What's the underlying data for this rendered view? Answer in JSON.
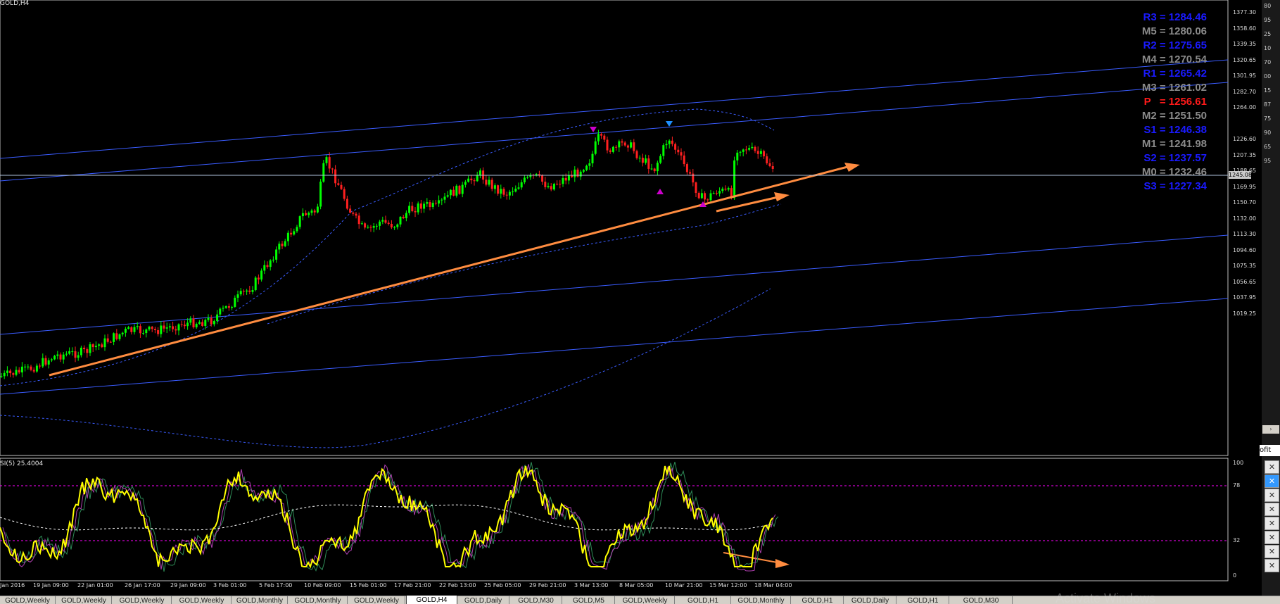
{
  "symbol_label": "GOLD,H4",
  "rsi_label": "SI(5) 25.4004",
  "current_price": "1245.08",
  "pivots": [
    {
      "text": "R3 = 1284.46",
      "color": "#1a1aff"
    },
    {
      "text": "M5 = 1280.06",
      "color": "#8a8a8a"
    },
    {
      "text": "R2 = 1275.65",
      "color": "#1a1aff"
    },
    {
      "text": "M4 = 1270.54",
      "color": "#8a8a8a"
    },
    {
      "text": "R1 = 1265.42",
      "color": "#1a1aff"
    },
    {
      "text": "M3 = 1261.02",
      "color": "#8a8a8a"
    },
    {
      "text": "P   = 1256.61",
      "color": "#ff1a1a"
    },
    {
      "text": "M2 = 1251.50",
      "color": "#8a8a8a"
    },
    {
      "text": "S1 = 1246.38",
      "color": "#1a1aff"
    },
    {
      "text": "M1 = 1241.98",
      "color": "#8a8a8a"
    },
    {
      "text": "S2 = 1237.57",
      "color": "#1a1aff"
    },
    {
      "text": "M0 = 1232.46",
      "color": "#8a8a8a"
    },
    {
      "text": "S3 = 1227.34",
      "color": "#1a1aff"
    }
  ],
  "price_axis": [
    "1377.30",
    "1358.60",
    "1339.35",
    "1320.65",
    "1301.95",
    "1282.70",
    "1264.00",
    "1245.08",
    "1226.60",
    "1207.35",
    "1188.65",
    "1169.95",
    "1150.70",
    "1132.00",
    "1113.30",
    "1094.60",
    "1075.35",
    "1056.65",
    "1037.95",
    "1019.25"
  ],
  "rsi_axis": [
    "100",
    "78",
    "32",
    "0"
  ],
  "time_axis": [
    "Jan 2016",
    "19 Jan 09:00",
    "22 Jan 01:00",
    "26 Jan 17:00",
    "29 Jan 09:00",
    "3 Feb 01:00",
    "5 Feb 17:00",
    "10 Feb 09:00",
    "15 Feb 01:00",
    "17 Feb 21:00",
    "22 Feb 13:00",
    "25 Feb 05:00",
    "29 Feb 21:00",
    "3 Mar 13:00",
    "8 Mar 05:00",
    "10 Mar 21:00",
    "15 Mar 12:00",
    "18 Mar 04:00"
  ],
  "tabs": [
    "GOLD,Weekly",
    "GOLD,Weekly",
    "GOLD,Weekly",
    "GOLD,Weekly",
    "GOLD,Monthly",
    "GOLD,Monthly",
    "GOLD,Weekly",
    "GOLD,H4",
    "GOLD,Daily",
    "GOLD,M30",
    "GOLD,M5",
    "GOLD,Weekly",
    "GOLD,H1",
    "GOLD,Monthly",
    "GOLD,H1",
    "GOLD,Daily",
    "GOLD,H1",
    "GOLD,M30"
  ],
  "active_tab_index": 7,
  "right_panel": {
    "label": "ofit",
    "numbers": [
      "80",
      "95",
      "25",
      "10",
      "70",
      "00",
      "15",
      "87",
      "75",
      "90",
      "65",
      "95"
    ]
  },
  "watermark": "Activate Windows",
  "colors": {
    "bull": "#00ff00",
    "bear": "#ff2020",
    "trendline": "#ff8c40",
    "channel": "#3a5cff",
    "rsi": "#ffff00",
    "level": "#ff00ff"
  },
  "chart_data": {
    "type": "candlestick",
    "ylim": [
      1019.25,
      1377.3
    ],
    "current_price": 1245.08,
    "rsi_ylim": [
      0,
      100
    ],
    "rsi_levels": [
      78,
      32
    ]
  }
}
